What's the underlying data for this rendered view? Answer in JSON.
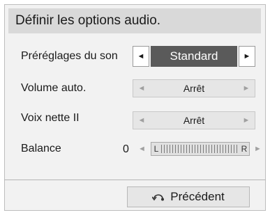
{
  "header": {
    "title": "Définir les options audio."
  },
  "rows": [
    {
      "label": "Préréglages du son",
      "value": "Standard",
      "left_icon": "left-arrow-icon",
      "right_icon": "right-arrow-icon"
    },
    {
      "label": "Volume auto.",
      "value": "Arrêt",
      "left_icon": "left-arrow-icon",
      "right_icon": "right-arrow-icon"
    },
    {
      "label": "Voix nette II",
      "value": "Arrêt",
      "left_icon": "left-arrow-icon",
      "right_icon": "right-arrow-icon"
    }
  ],
  "balance": {
    "label": "Balance",
    "value": "0",
    "left_label": "L",
    "right_label": "R",
    "level": 0.5
  },
  "footer": {
    "back_label": "Précédent",
    "back_icon": "back-arrow-icon"
  },
  "arrows": {
    "left": "◄",
    "right": "►"
  },
  "colors": {
    "panel_bg": "#f2f2f2",
    "header_bg": "#d9d9d9",
    "active_value_bg": "#5a5a5a",
    "inactive_bg": "#e6e6e6",
    "disabled_arrow": "#a0a0a0"
  }
}
